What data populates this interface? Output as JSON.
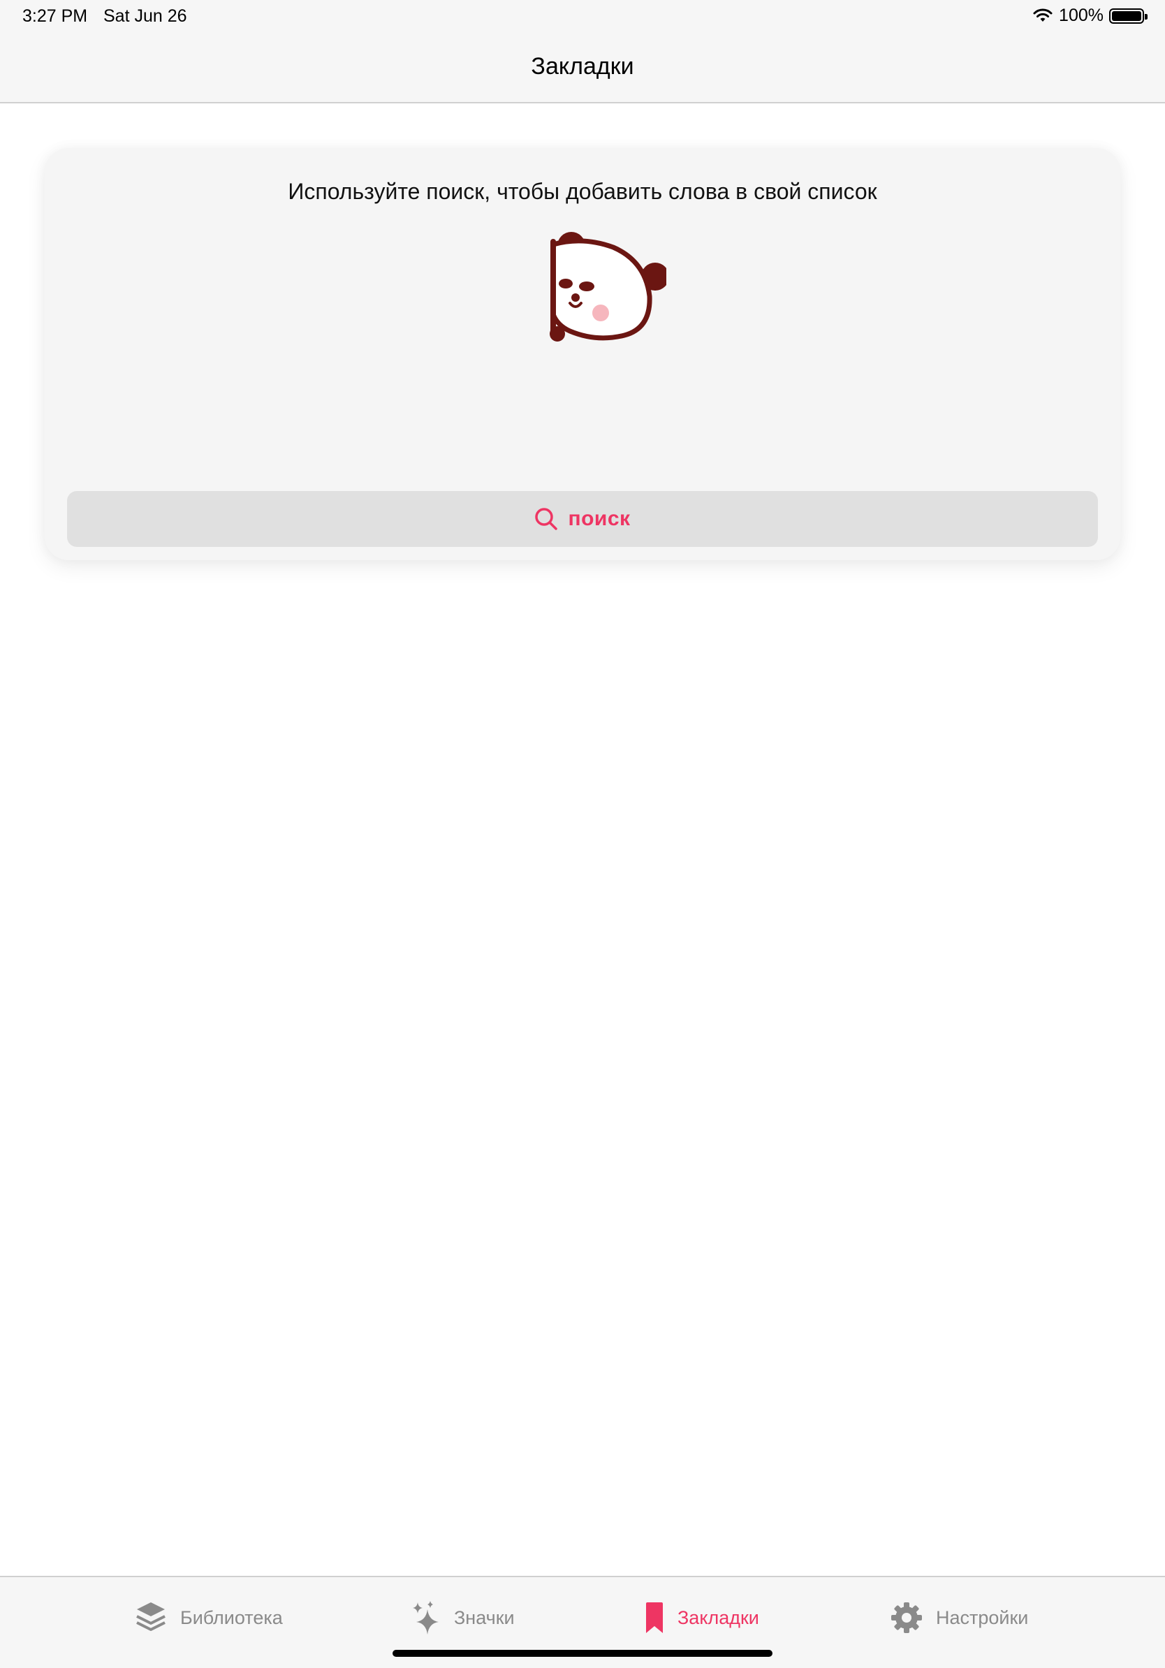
{
  "status_bar": {
    "time": "3:27 PM",
    "date": "Sat Jun 26",
    "battery_percent": "100%",
    "battery_level": 1.0
  },
  "nav": {
    "title": "Закладки"
  },
  "card": {
    "message": "Используйте поиск, чтобы добавить слова в свой список",
    "illustration": "panda-peeking",
    "search_button_label": "поиск",
    "search_icon": "search-icon"
  },
  "tabs": [
    {
      "label": "Библиотека",
      "icon": "layers-icon",
      "active": false
    },
    {
      "label": "Значки",
      "icon": "sparkles-icon",
      "active": false
    },
    {
      "label": "Закладки",
      "icon": "bookmark-icon",
      "active": true
    },
    {
      "label": "Настройки",
      "icon": "gear-icon",
      "active": false
    }
  ],
  "colors": {
    "accent": "#ee3563",
    "inactive": "#8a8a8a",
    "panda_outline": "#6b1612",
    "panda_cheek": "#f6b6bd",
    "background_bar": "#f6f6f6",
    "card_background": "#f5f5f5",
    "button_background": "#e0e0e0"
  }
}
